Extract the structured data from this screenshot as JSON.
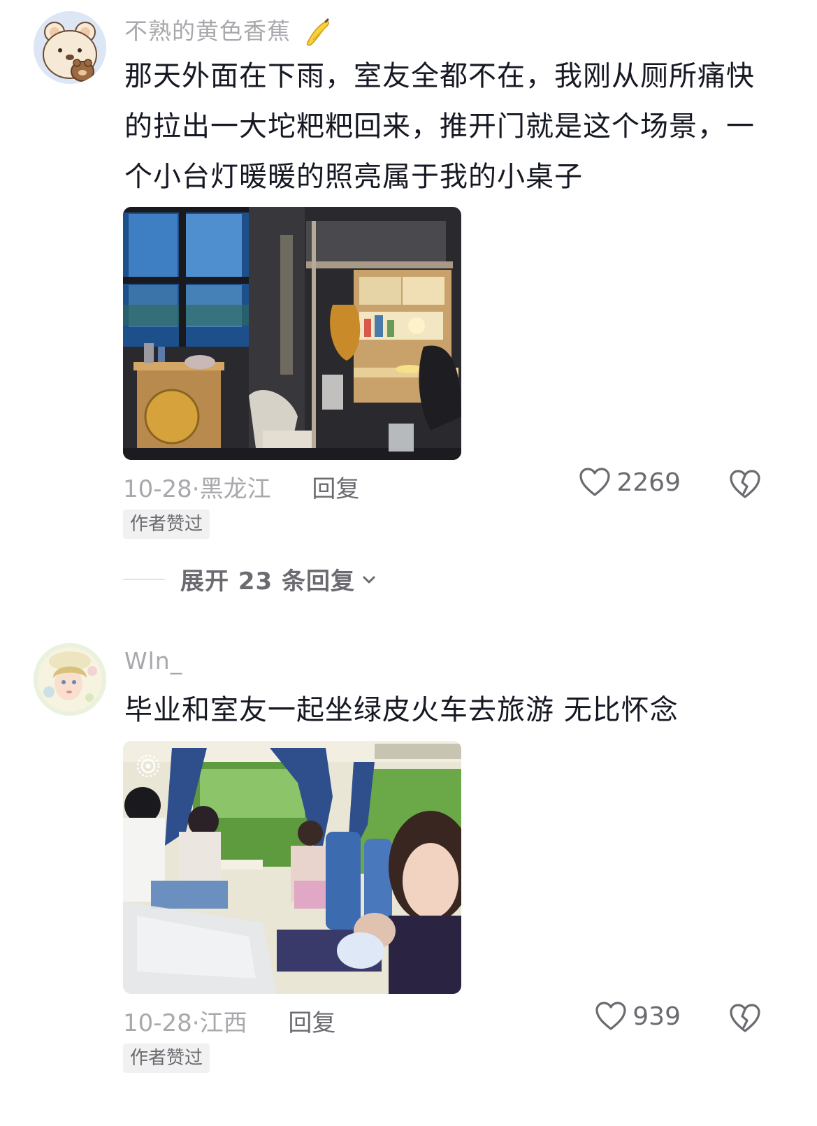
{
  "comments": [
    {
      "username": "不熟的黄色香蕉",
      "avatar_icon": "bear-avatar-icon",
      "text": "那天外面在下雨，室友全都不在，我刚从厕所痛快的拉出一大坨粑粑回来，推开门就是这个场景，一个小台灯暖暖的照亮属于我的小桌子",
      "date": "10-28",
      "location": "黑龙江",
      "reply_label": "回复",
      "likes": "2269",
      "badge": "作者赞过",
      "expand_label": "展开 23 条回复"
    },
    {
      "username": "Wln_",
      "avatar_icon": "illustrated-girl-avatar-icon",
      "text": "毕业和室友一起坐绿皮火车去旅游 无比怀念",
      "date": "10-28",
      "location": "江西",
      "reply_label": "回复",
      "likes": "939",
      "badge": "作者赞过"
    }
  ],
  "meta_separator": "·",
  "colors": {
    "text": "#161823",
    "muted": "#a8a8ad",
    "secondary": "#6a6a70"
  }
}
